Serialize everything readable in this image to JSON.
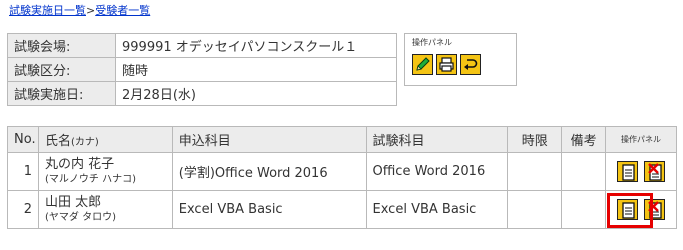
{
  "breadcrumb": {
    "items": [
      "試験実施日一覧",
      "受験者一覧"
    ],
    "separator": ">"
  },
  "exam_info": {
    "venue_label": "試験会場:",
    "venue_value": "999991 オデッセイパソコンスクール１",
    "category_label": "試験区分:",
    "category_value": "随時",
    "date_label": "試験実施日:",
    "date_value": "2月28日(水)"
  },
  "op_panel": {
    "title": "操作パネル",
    "buttons": [
      "pencil-icon",
      "printer-icon",
      "return-icon"
    ]
  },
  "table": {
    "headers": {
      "no": "No.",
      "name": "氏名",
      "name_kana": "(カナ)",
      "applied_subject": "申込科目",
      "exam_subject": "試験科目",
      "period": "時限",
      "remarks": "備考",
      "ops": "操作パネル"
    },
    "rows": [
      {
        "no": "1",
        "name": "丸の内 花子",
        "kana": "(マルノウチ ハナコ)",
        "applied_subject": "(学割)Office Word 2016",
        "exam_subject": "Office Word 2016",
        "period": "",
        "remarks": ""
      },
      {
        "no": "2",
        "name": "山田 太郎",
        "kana": "(ヤマダ タロウ)",
        "applied_subject": "Excel VBA Basic",
        "exam_subject": "Excel VBA Basic",
        "period": "",
        "remarks": ""
      }
    ]
  },
  "colors": {
    "link": "#0033cc",
    "header_bg": "#ececec",
    "border": "#b9b9b9",
    "button_bg": "#f4c414",
    "highlight": "#e60000"
  }
}
